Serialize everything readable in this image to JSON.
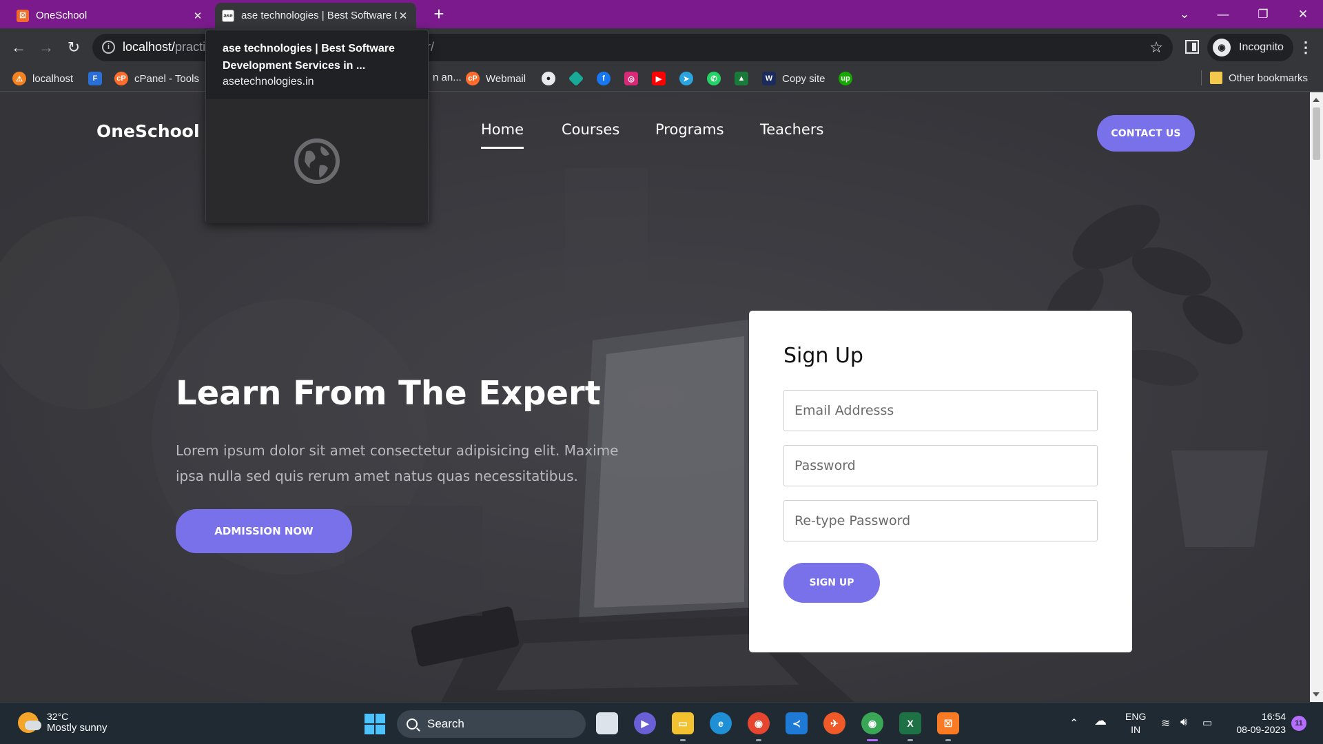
{
  "browser": {
    "tabs": [
      {
        "title": "OneSchool",
        "favicon": "xampp-icon"
      },
      {
        "title": "ase technologies | Best Software D",
        "favicon": "ase-icon"
      }
    ],
    "url_host": "localhost/",
    "url_path_visible": "practi",
    "url_tail": "r/",
    "profile_label": "Incognito",
    "bookmarks": [
      {
        "label": "localhost",
        "icon": "xampp-logo-icon"
      },
      {
        "label": "",
        "icon": "flashscore-icon"
      },
      {
        "label": "cPanel - Tools",
        "icon": "cpanel-icon"
      },
      {
        "label": "n an...",
        "icon": ""
      },
      {
        "label": "Webmail",
        "icon": "cpanel-icon"
      },
      {
        "label": "",
        "icon": "github-icon"
      },
      {
        "label": "",
        "icon": "diamond-icon"
      },
      {
        "label": "",
        "icon": "facebook-icon"
      },
      {
        "label": "",
        "icon": "instagram-icon"
      },
      {
        "label": "",
        "icon": "youtube-icon"
      },
      {
        "label": "",
        "icon": "telegram-icon"
      },
      {
        "label": "",
        "icon": "whatsapp-icon"
      },
      {
        "label": "",
        "icon": "android-icon"
      },
      {
        "label": "Copy site",
        "icon": "copy-site-icon"
      },
      {
        "label": "",
        "icon": "upwork-icon"
      }
    ],
    "other_bookmarks": "Other bookmarks"
  },
  "tab_preview": {
    "title": "ase technologies | Best Software Development Services in ...",
    "domain": "asetechnologies.in"
  },
  "site": {
    "brand": "OneSchool",
    "nav": [
      "Home",
      "Courses",
      "Programs",
      "Teachers"
    ],
    "active_nav": "Home",
    "contact_label": "CONTACT US",
    "hero_title": "Learn From The Expert",
    "hero_text": "Lorem ipsum dolor sit amet consectetur adipisicing elit. Maxime ipsa nulla sed quis rerum amet natus quas necessitatibus.",
    "admission_label": "ADMISSION NOW",
    "signup": {
      "title": "Sign Up",
      "email_placeholder": "Email Addresss",
      "password_placeholder": "Password",
      "retype_placeholder": "Re-type Password",
      "button_label": "SIGN UP"
    }
  },
  "taskbar": {
    "weather_temp": "32°C",
    "weather_desc": "Mostly sunny",
    "search_label": "Search",
    "lang_top": "ENG",
    "lang_bottom": "IN",
    "time": "16:54",
    "date": "08-09-2023",
    "notifications": "11"
  },
  "colors": {
    "accent": "#7971ea",
    "tabstrip": "#7b1a8c",
    "hero_overlay": "#3c3c41"
  }
}
